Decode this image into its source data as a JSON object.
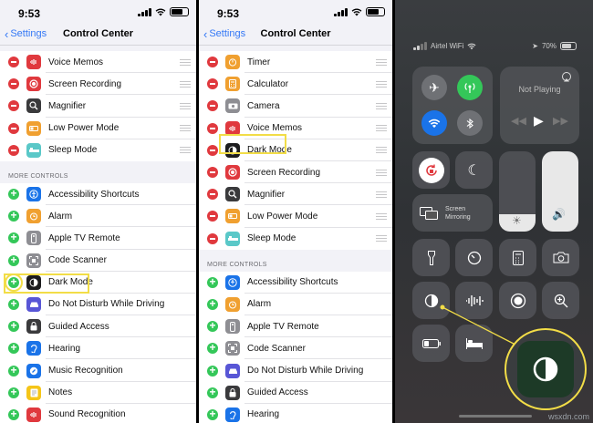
{
  "status": {
    "time": "9:53"
  },
  "nav": {
    "back": "Settings",
    "title": "Control Center"
  },
  "panel1": {
    "included": [
      "Voice Memos",
      "Screen Recording",
      "Magnifier",
      "Low Power Mode",
      "Sleep Mode"
    ],
    "section": "MORE CONTROLS",
    "more": [
      "Accessibility Shortcuts",
      "Alarm",
      "Apple TV Remote",
      "Code Scanner",
      "Dark Mode",
      "Do Not Disturb While Driving",
      "Guided Access",
      "Hearing",
      "Music Recognition",
      "Notes",
      "Sound Recognition"
    ]
  },
  "panel2": {
    "included": [
      "Timer",
      "Calculator",
      "Camera",
      "Voice Memos",
      "Dark Mode",
      "Screen Recording",
      "Magnifier",
      "Low Power Mode",
      "Sleep Mode"
    ],
    "section": "MORE CONTROLS",
    "more": [
      "Accessibility Shortcuts",
      "Alarm",
      "Apple TV Remote",
      "Code Scanner",
      "Do Not Disturb While Driving",
      "Guided Access",
      "Hearing"
    ]
  },
  "control_center": {
    "carrier": "Airtel WiFi",
    "battery": "70%",
    "now_playing": "Not Playing",
    "screen_mirroring": "Screen Mirroring"
  },
  "watermark": "wsxdn.com",
  "colors": {
    "highlight": "#f2dd47",
    "minus": "#e0393e",
    "plus": "#34c759",
    "accent": "#3478f6"
  }
}
